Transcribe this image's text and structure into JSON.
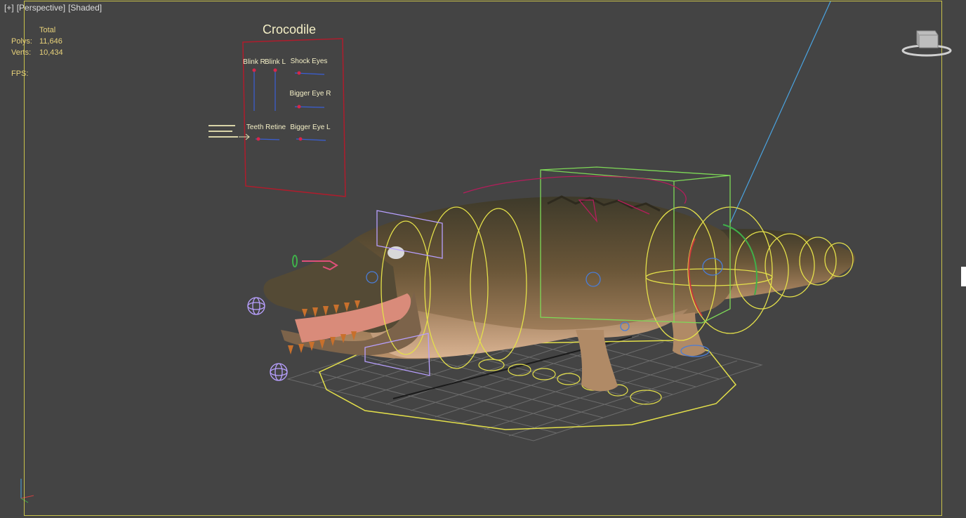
{
  "viewport": {
    "labels": [
      "[+]",
      "[Perspective]",
      "[Shaded]"
    ],
    "stats": {
      "header": "Total",
      "polys_label": "Polys:",
      "polys_value": "11,646",
      "verts_label": "Verts:",
      "verts_value": "10,434",
      "fps_label": "FPS:"
    }
  },
  "control_panel": {
    "title": "Crocodile",
    "controls": [
      "Blink R",
      "Blink L",
      "Shock Eyes",
      "Bigger Eye R",
      "Teeth Retine",
      "Bigger Eye L"
    ]
  },
  "colors": {
    "viewport_bg": "#444444",
    "safe_frame": "#c9c24a",
    "stat_text": "#e8d27a",
    "rig_yellow": "#e4e04a",
    "rig_green": "#7ed957",
    "rig_purple": "#b8a0ff",
    "panel_border": "#b01c2c"
  },
  "icons": {
    "viewcube": "viewcube-icon",
    "axis": "axis-tripod-icon"
  }
}
